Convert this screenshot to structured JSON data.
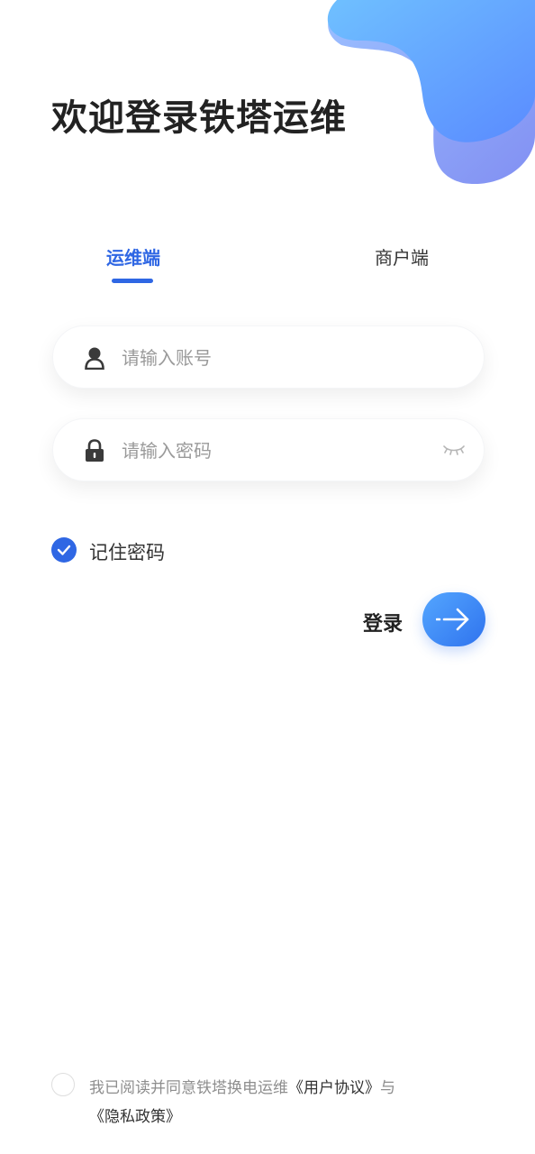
{
  "header": {
    "title": "欢迎登录铁塔运维"
  },
  "tabs": {
    "ops_label": "运维端",
    "merchant_label": "商户端",
    "active": "运维端"
  },
  "form": {
    "account_placeholder": "请输入账号",
    "account_value": "",
    "password_placeholder": "请输入密码",
    "password_value": "",
    "remember_label": "记住密码",
    "remember_checked": true
  },
  "login": {
    "label": "登录"
  },
  "agreement": {
    "checked": false,
    "prefix": "我已阅读并同意铁塔换电运维",
    "user_agreement": "《用户协议》",
    "conjunction": "与",
    "privacy_policy": "《隐私政策》"
  },
  "colors": {
    "accent": "#2f67e4",
    "button_gradient_start": "#54a6ff",
    "button_gradient_end": "#2f73ee"
  },
  "icons": {
    "account": "user-icon",
    "password": "lock-icon",
    "visibility": "eye-closed-icon",
    "remember": "check-icon",
    "login": "arrow-right-icon"
  }
}
